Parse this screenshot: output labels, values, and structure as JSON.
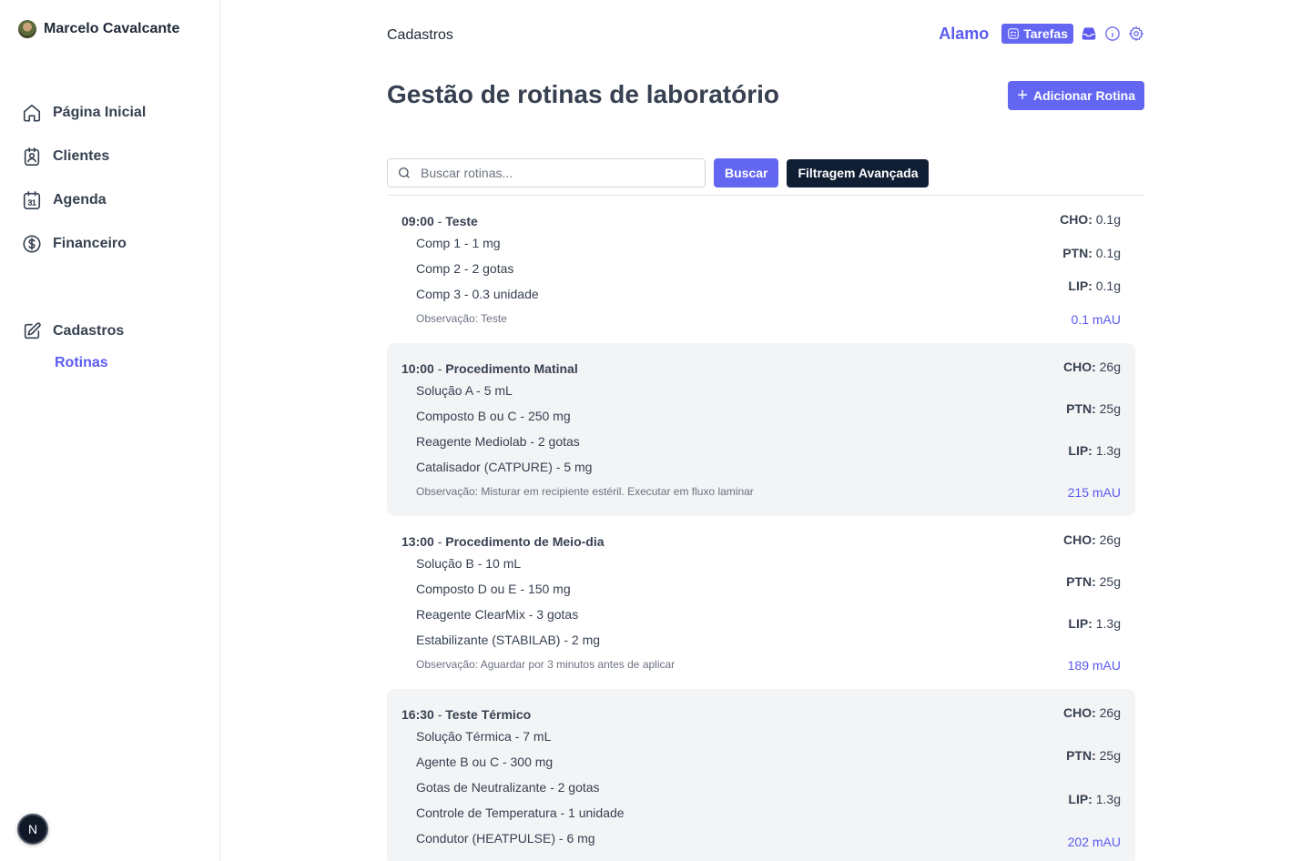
{
  "user": {
    "name": "Marcelo Cavalcante"
  },
  "sidebar": {
    "items": [
      {
        "label": "Página Inicial",
        "icon": "home-icon"
      },
      {
        "label": "Clientes",
        "icon": "badge-icon"
      },
      {
        "label": "Agenda",
        "icon": "calendar-icon"
      },
      {
        "label": "Financeiro",
        "icon": "dollar-icon"
      }
    ],
    "section": {
      "label": "Cadastros",
      "icon": "edit-icon"
    },
    "sub_item": "Rotinas",
    "badge": "N"
  },
  "header": {
    "breadcrumb": "Cadastros",
    "brand": "Alamo",
    "tasks_label": "Tarefas",
    "title": "Gestão de rotinas de laboratório",
    "add_label": "Adicionar Rotina"
  },
  "search": {
    "placeholder": "Buscar rotinas...",
    "search_label": "Buscar",
    "filter_label": "Filtragem Avançada"
  },
  "routines": [
    {
      "time": "09:00",
      "name": "Teste",
      "components": [
        "Comp 1 - 1 mg",
        "Comp 2 - 2 gotas",
        "Comp 3 - 0.3 unidade"
      ],
      "observation": "Observação: Teste",
      "cho": "0.1g",
      "ptn": "0.1g",
      "lip": "0.1g",
      "mau": "0.1 mAU"
    },
    {
      "time": "10:00",
      "name": "Procedimento Matinal",
      "components": [
        "Solução A - 5 mL",
        "Composto B ou C - 250 mg",
        "Reagente Mediolab - 2 gotas",
        "Catalisador (CATPURE) - 5 mg"
      ],
      "observation": "Observação: Misturar em recipiente estéril. Executar em fluxo laminar",
      "cho": "26g",
      "ptn": "25g",
      "lip": "1.3g",
      "mau": "215 mAU"
    },
    {
      "time": "13:00",
      "name": "Procedimento de Meio-dia",
      "components": [
        "Solução B - 10 mL",
        "Composto D ou E - 150 mg",
        "Reagente ClearMix - 3 gotas",
        "Estabilizante (STABILAB) - 2 mg"
      ],
      "observation": "Observação: Aguardar por 3 minutos antes de aplicar",
      "cho": "26g",
      "ptn": "25g",
      "lip": "1.3g",
      "mau": "189 mAU"
    },
    {
      "time": "16:30",
      "name": "Teste Térmico",
      "components": [
        "Solução Térmica - 7 mL",
        "Agente B ou C - 300 mg",
        "Gotas de Neutralizante - 2 gotas",
        "Controle de Temperatura - 1 unidade",
        "Condutor (HEATPULSE) - 6 mg"
      ],
      "observation": "",
      "cho": "26g",
      "ptn": "25g",
      "lip": "1.3g",
      "mau": "202 mAU"
    }
  ],
  "labels": {
    "cho": "CHO:",
    "ptn": "PTN:",
    "lip": "LIP:",
    "dash": "-"
  }
}
